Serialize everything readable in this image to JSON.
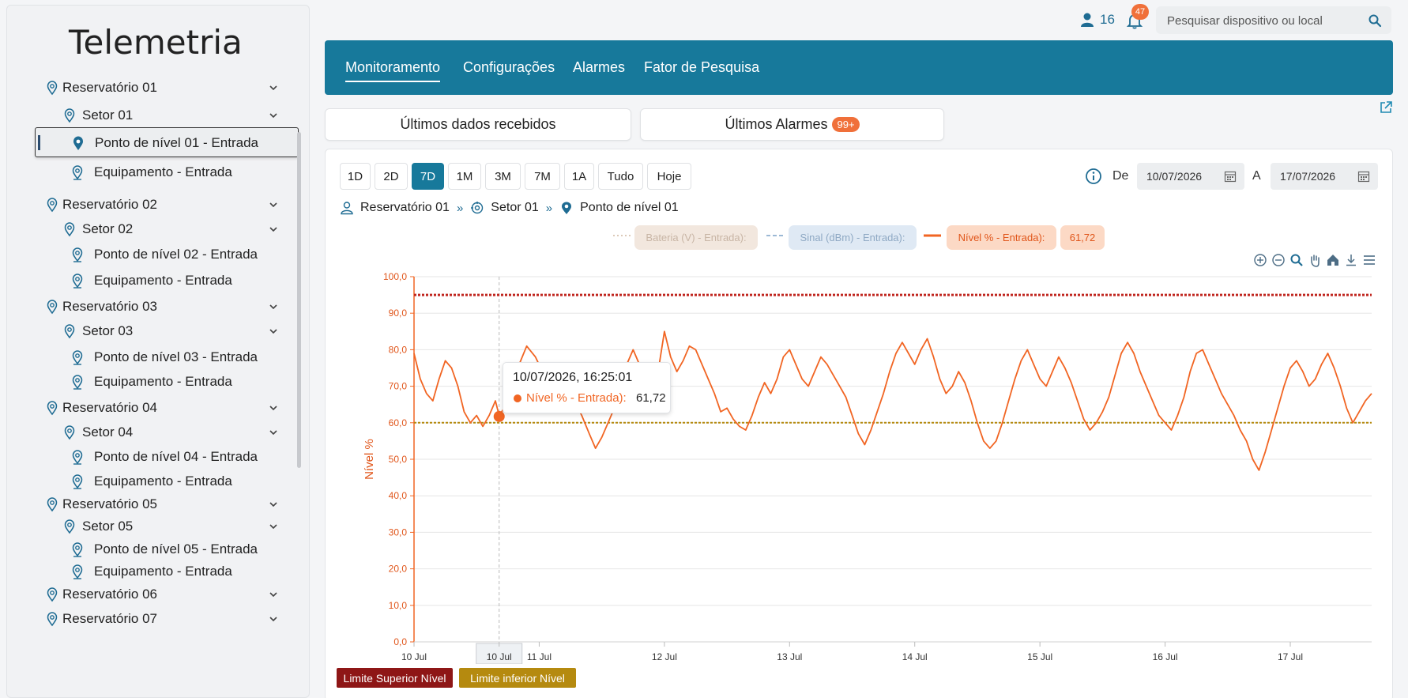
{
  "sidebar": {
    "title": "Telemetria",
    "items": [
      {
        "label": "Reservatório 01",
        "level": 0,
        "expandable": true
      },
      {
        "label": "Setor 01",
        "level": 1,
        "expandable": true
      },
      {
        "label": "Ponto de nível 01 - Entrada",
        "level": 2,
        "active": true
      },
      {
        "label": "Equipamento - Entrada",
        "level": 2
      },
      {
        "label": "Reservatório 02",
        "level": 0,
        "expandable": true
      },
      {
        "label": "Setor 02",
        "level": 1,
        "expandable": true
      },
      {
        "label": "Ponto de nível 02 - Entrada",
        "level": 2
      },
      {
        "label": "Equipamento - Entrada",
        "level": 2
      },
      {
        "label": "Reservatório 03",
        "level": 0,
        "expandable": true
      },
      {
        "label": "Setor 03",
        "level": 1,
        "expandable": true
      },
      {
        "label": "Ponto de nível 03 - Entrada",
        "level": 2
      },
      {
        "label": "Equipamento - Entrada",
        "level": 2
      },
      {
        "label": "Reservatório 04",
        "level": 0,
        "expandable": true
      },
      {
        "label": "Setor 04",
        "level": 1,
        "expandable": true
      },
      {
        "label": "Ponto de nível 04 - Entrada",
        "level": 2
      },
      {
        "label": "Equipamento - Entrada",
        "level": 2
      },
      {
        "label": "Reservatório 05",
        "level": 0,
        "expandable": true
      },
      {
        "label": "Setor 05",
        "level": 1,
        "expandable": true
      },
      {
        "label": "Ponto de nível 05 - Entrada",
        "level": 2
      },
      {
        "label": "Equipamento - Entrada",
        "level": 2
      },
      {
        "label": "Reservatório 06",
        "level": 0,
        "expandable": true
      },
      {
        "label": "Reservatório 07",
        "level": 0,
        "expandable": true
      }
    ]
  },
  "topbar": {
    "user_count": "16",
    "notification_count": "47",
    "search_placeholder": "Pesquisar dispositivo ou local"
  },
  "nav": {
    "tabs": [
      "Monitoramento",
      "Configurações",
      "Alarmes",
      "Fator de Pesquisa"
    ],
    "active_tab": "Monitoramento"
  },
  "panels": {
    "last_data": "Últimos dados recebidos",
    "last_alarms": "Últimos Alarmes",
    "alarms_badge": "99+"
  },
  "range": {
    "buttons": [
      "1D",
      "2D",
      "7D",
      "1M",
      "3M",
      "7M",
      "1A",
      "Tudo",
      "Hoje"
    ],
    "active": "7D",
    "from_label": "De",
    "from_date": "10/07/2026",
    "to_label": "A",
    "to_date": "17/07/2026"
  },
  "breadcrumb": {
    "reservoir": "Reservatório 01",
    "sector": "Setor 01",
    "point": "Ponto de nível 01"
  },
  "legend": {
    "battery": "Bateria (V) - Entrada):",
    "signal": "Sinal (dBm) - Entrada):",
    "level": "Nível % - Entrada):",
    "level_value": "61,72"
  },
  "limits": {
    "upper_label": "Limite Superior Nível",
    "lower_label": "Limite inferior Nível"
  },
  "tooltip": {
    "time": "10/07/2026, 16:25:01",
    "series": "Nível % - Entrada):",
    "value": "61,72"
  },
  "colors": {
    "accent": "#17799b",
    "series": "#f16523",
    "upper_limit": "#c0261f",
    "lower_limit": "#b58a0f",
    "badge": "#f0703a"
  },
  "chart_data": {
    "type": "line",
    "ylabel": "Nível %",
    "ylim": [
      0,
      100
    ],
    "y_ticks": [
      "0,0",
      "10,0",
      "20,0",
      "30,0",
      "40,0",
      "50,0",
      "60,0",
      "70,0",
      "80,0",
      "90,0",
      "100,0"
    ],
    "x_ticks": [
      {
        "label": "10 Jul",
        "day": 0
      },
      {
        "label": "10 Jul",
        "day": 0.68,
        "highlighted": true
      },
      {
        "label": "11 Jul",
        "day": 1
      },
      {
        "label": "12 Jul",
        "day": 2
      },
      {
        "label": "13 Jul",
        "day": 3
      },
      {
        "label": "14 Jul",
        "day": 4
      },
      {
        "label": "15 Jul",
        "day": 5
      },
      {
        "label": "16 Jul",
        "day": 6
      },
      {
        "label": "17 Jul",
        "day": 7
      }
    ],
    "x_range_days": [
      0,
      7.65
    ],
    "upper_limit": 95,
    "lower_limit": 60,
    "series": [
      {
        "name": "Nível % - Entrada)",
        "points": [
          [
            0.0,
            79
          ],
          [
            0.05,
            72
          ],
          [
            0.1,
            68
          ],
          [
            0.15,
            66
          ],
          [
            0.2,
            72
          ],
          [
            0.25,
            77
          ],
          [
            0.3,
            75
          ],
          [
            0.35,
            70
          ],
          [
            0.4,
            63
          ],
          [
            0.45,
            60
          ],
          [
            0.5,
            62
          ],
          [
            0.55,
            59
          ],
          [
            0.6,
            62
          ],
          [
            0.65,
            66
          ],
          [
            0.68,
            62
          ],
          [
            0.72,
            64
          ],
          [
            0.78,
            70
          ],
          [
            0.84,
            76
          ],
          [
            0.9,
            81
          ],
          [
            0.97,
            78
          ],
          [
            1.04,
            73
          ],
          [
            1.1,
            76
          ],
          [
            1.16,
            70
          ],
          [
            1.22,
            64
          ],
          [
            1.28,
            66
          ],
          [
            1.34,
            62
          ],
          [
            1.4,
            57
          ],
          [
            1.45,
            53
          ],
          [
            1.5,
            56
          ],
          [
            1.55,
            60
          ],
          [
            1.6,
            64
          ],
          [
            1.65,
            70
          ],
          [
            1.7,
            76
          ],
          [
            1.75,
            80
          ],
          [
            1.8,
            76
          ],
          [
            1.85,
            72
          ],
          [
            1.9,
            69
          ],
          [
            1.95,
            74
          ],
          [
            2.0,
            85
          ],
          [
            2.05,
            78
          ],
          [
            2.1,
            74
          ],
          [
            2.15,
            77
          ],
          [
            2.2,
            81
          ],
          [
            2.25,
            80
          ],
          [
            2.3,
            76
          ],
          [
            2.35,
            72
          ],
          [
            2.4,
            68
          ],
          [
            2.45,
            63
          ],
          [
            2.5,
            64
          ],
          [
            2.55,
            61
          ],
          [
            2.6,
            59
          ],
          [
            2.65,
            58
          ],
          [
            2.7,
            62
          ],
          [
            2.75,
            67
          ],
          [
            2.8,
            71
          ],
          [
            2.85,
            68
          ],
          [
            2.9,
            72
          ],
          [
            2.95,
            78
          ],
          [
            3.0,
            80
          ],
          [
            3.05,
            76
          ],
          [
            3.1,
            72
          ],
          [
            3.15,
            70
          ],
          [
            3.2,
            74
          ],
          [
            3.25,
            78
          ],
          [
            3.3,
            76
          ],
          [
            3.35,
            73
          ],
          [
            3.4,
            70
          ],
          [
            3.45,
            67
          ],
          [
            3.5,
            62
          ],
          [
            3.55,
            57
          ],
          [
            3.6,
            54
          ],
          [
            3.65,
            58
          ],
          [
            3.7,
            63
          ],
          [
            3.75,
            68
          ],
          [
            3.8,
            74
          ],
          [
            3.85,
            79
          ],
          [
            3.9,
            82
          ],
          [
            3.95,
            79
          ],
          [
            4.0,
            76
          ],
          [
            4.05,
            80
          ],
          [
            4.1,
            83
          ],
          [
            4.15,
            78
          ],
          [
            4.2,
            72
          ],
          [
            4.25,
            68
          ],
          [
            4.3,
            70
          ],
          [
            4.35,
            74
          ],
          [
            4.4,
            71
          ],
          [
            4.45,
            66
          ],
          [
            4.5,
            60
          ],
          [
            4.55,
            55
          ],
          [
            4.6,
            53
          ],
          [
            4.65,
            55
          ],
          [
            4.7,
            60
          ],
          [
            4.75,
            66
          ],
          [
            4.8,
            72
          ],
          [
            4.85,
            77
          ],
          [
            4.9,
            80
          ],
          [
            4.95,
            76
          ],
          [
            5.0,
            72
          ],
          [
            5.05,
            70
          ],
          [
            5.1,
            74
          ],
          [
            5.15,
            78
          ],
          [
            5.2,
            75
          ],
          [
            5.25,
            71
          ],
          [
            5.3,
            66
          ],
          [
            5.35,
            61
          ],
          [
            5.4,
            58
          ],
          [
            5.45,
            60
          ],
          [
            5.5,
            63
          ],
          [
            5.55,
            67
          ],
          [
            5.6,
            73
          ],
          [
            5.65,
            79
          ],
          [
            5.7,
            82
          ],
          [
            5.75,
            79
          ],
          [
            5.8,
            74
          ],
          [
            5.85,
            70
          ],
          [
            5.9,
            66
          ],
          [
            5.95,
            62
          ],
          [
            6.0,
            60
          ],
          [
            6.05,
            58
          ],
          [
            6.1,
            62
          ],
          [
            6.15,
            67
          ],
          [
            6.2,
            74
          ],
          [
            6.25,
            79
          ],
          [
            6.3,
            80
          ],
          [
            6.35,
            76
          ],
          [
            6.4,
            72
          ],
          [
            6.45,
            68
          ],
          [
            6.5,
            65
          ],
          [
            6.55,
            62
          ],
          [
            6.6,
            58
          ],
          [
            6.65,
            55
          ],
          [
            6.7,
            50
          ],
          [
            6.75,
            47
          ],
          [
            6.8,
            52
          ],
          [
            6.85,
            58
          ],
          [
            6.9,
            64
          ],
          [
            6.95,
            70
          ],
          [
            7.0,
            75
          ],
          [
            7.05,
            77
          ],
          [
            7.1,
            74
          ],
          [
            7.15,
            70
          ],
          [
            7.2,
            72
          ],
          [
            7.25,
            76
          ],
          [
            7.3,
            79
          ],
          [
            7.35,
            75
          ],
          [
            7.4,
            70
          ],
          [
            7.45,
            64
          ],
          [
            7.5,
            60
          ],
          [
            7.55,
            63
          ],
          [
            7.6,
            66
          ],
          [
            7.65,
            68
          ]
        ]
      }
    ],
    "highlight_point": {
      "day": 0.68,
      "value": 61.72
    }
  }
}
